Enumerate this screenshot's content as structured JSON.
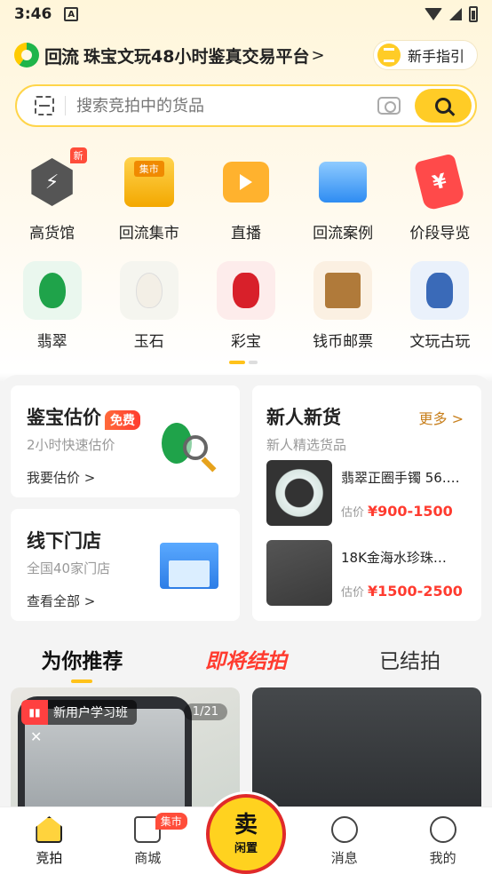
{
  "status_bar": {
    "time": "3:46",
    "notif_letter": "A"
  },
  "header": {
    "brand": "回流",
    "slogan": "珠宝文玩48小时鉴真交易平台",
    "arrow": ">",
    "guide_label": "新手指引"
  },
  "search": {
    "placeholder": "搜索竞拍中的货品"
  },
  "categories_row1": [
    {
      "label": "高货馆",
      "badge": "新",
      "glyph": "⚡"
    },
    {
      "label": "回流集市",
      "tag": "集市"
    },
    {
      "label": "直播"
    },
    {
      "label": "回流案例"
    },
    {
      "label": "价段导览",
      "glyph": "¥"
    }
  ],
  "categories_row2": [
    {
      "label": "翡翠",
      "color": "#1fa34a",
      "bg": "#eaf7ee"
    },
    {
      "label": "玉石",
      "color": "#f3efe6",
      "bg": "#f5f5ef"
    },
    {
      "label": "彩宝",
      "color": "#d8202a",
      "bg": "#fdeceb"
    },
    {
      "label": "钱币邮票",
      "color": "#b07a3a",
      "bg": "#fbf0e2"
    },
    {
      "label": "文玩古玩",
      "color": "#3a6ab8",
      "bg": "#eaf1fb"
    }
  ],
  "appraisal": {
    "title": "鉴宝估价",
    "badge": "免费",
    "subtitle": "2小时快速估价",
    "link": "我要估价 >"
  },
  "stores": {
    "title": "线下门店",
    "subtitle": "全国40家门店",
    "link": "查看全部 >"
  },
  "new_goods": {
    "title": "新人新货",
    "subtitle": "新人精选货品",
    "more": "更多 >",
    "items": [
      {
        "name": "翡翠正圈手镯 56.…",
        "price_label": "估价",
        "price": "¥900-1500"
      },
      {
        "name": "18K金海水珍珠…",
        "price_label": "估价",
        "price": "¥1500-2500"
      }
    ]
  },
  "tabs": [
    "为你推荐",
    "即将结拍",
    "已结拍"
  ],
  "feed": {
    "live_label": "新用户学习班",
    "counter": "1/21",
    "close": "✕"
  },
  "bottom_nav": {
    "items": [
      "竞拍",
      "商城",
      "消息",
      "我的"
    ],
    "market_badge": "集市",
    "sell_big": "卖",
    "sell_small": "闲置"
  },
  "colors": {
    "accent": "#ffcc26",
    "price": "#ff3b2f",
    "more": "#c8801e"
  }
}
